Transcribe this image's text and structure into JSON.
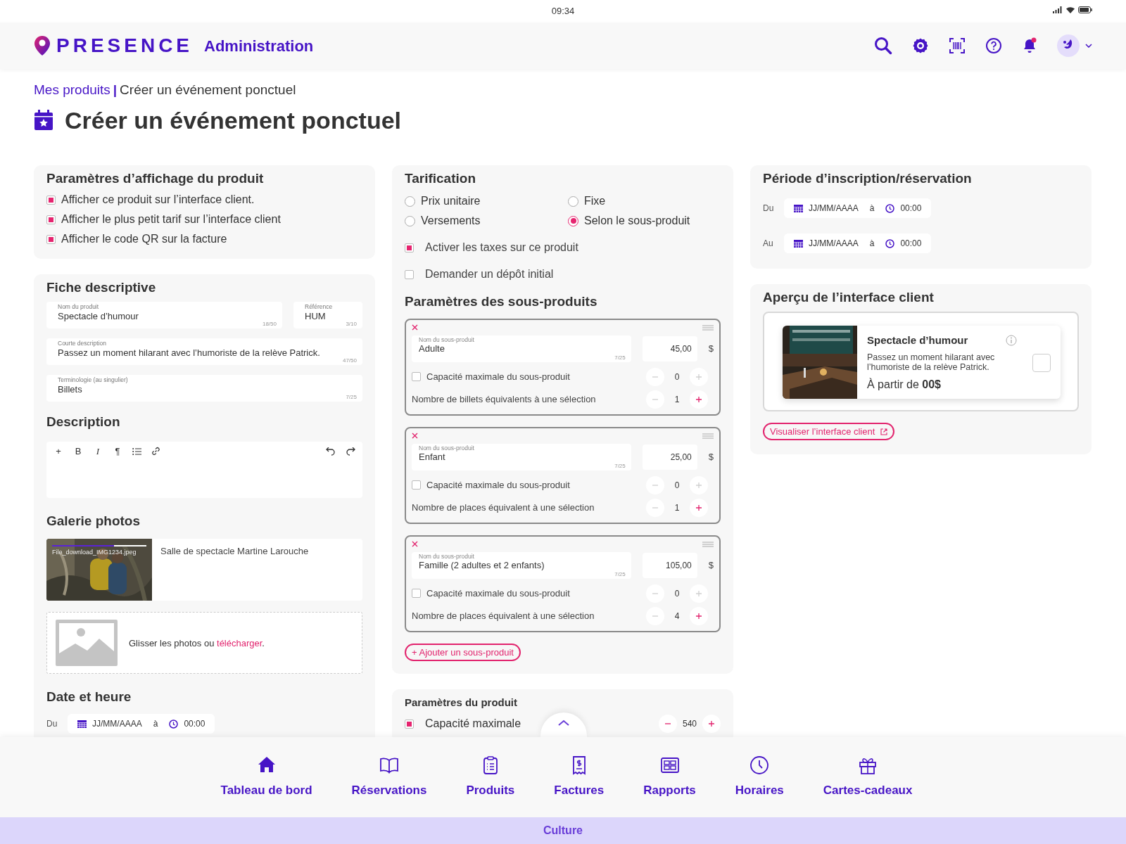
{
  "status_bar": {
    "time": "09:34"
  },
  "header": {
    "brand": "PRESENCE",
    "subtitle": "Administration"
  },
  "breadcrumb": {
    "link": "Mes produits",
    "separator": "|",
    "current": "Créer un événement ponctuel"
  },
  "page_title": "Créer un événement ponctuel",
  "display_settings": {
    "title": "Paramètres d’affichage du produit",
    "options": [
      {
        "label": "Afficher ce produit sur l’interface client.",
        "checked": true
      },
      {
        "label": "Afficher le plus petit tarif sur l’interface client",
        "checked": true
      },
      {
        "label": "Afficher le code QR sur la facture",
        "checked": true
      }
    ]
  },
  "fiche": {
    "title": "Fiche descriptive",
    "fields": [
      {
        "label": "Nom du produit",
        "value": "Spectacle d’humour",
        "counter": "18/50"
      },
      {
        "label": "Référence",
        "value": "HUM",
        "counter": "3/10"
      },
      {
        "label": "Courte description",
        "value": "Passez un moment hilarant avec l’humoriste de la relève Patrick.",
        "counter": "47/50"
      },
      {
        "label": "Terminologie (au singulier)",
        "value": "Billets",
        "counter": "7/25"
      }
    ]
  },
  "description": {
    "title": "Description",
    "toolbar": [
      {
        "kind": "glyph",
        "text": "+"
      },
      {
        "kind": "glyph",
        "text": "B"
      },
      {
        "kind": "italic",
        "text": "I"
      },
      {
        "kind": "glyph",
        "text": "¶"
      },
      {
        "kind": "list"
      },
      {
        "kind": "link"
      }
    ],
    "history": [
      {
        "kind": "undo"
      },
      {
        "kind": "redo"
      }
    ]
  },
  "gallery": {
    "title": "Galerie photos",
    "photos": [
      {
        "filename": "File_download_IMG1234.jpeg",
        "level": 0.66,
        "caption": "Salle de spectacle Martine Larouche"
      }
    ],
    "upload": {
      "text": "Glisser les photos ou",
      "link": "télécharger",
      "after": "."
    }
  },
  "date_time": {
    "title": "Date et heure",
    "rows": [
      {
        "label": "Du",
        "date": "JJ/MM/AAAA",
        "at": "à",
        "time": "00:00"
      }
    ]
  },
  "pricing": {
    "title": "Tarification",
    "modes": [
      {
        "label": "Prix unitaire",
        "selected": false
      },
      {
        "label": "Fixe",
        "selected": false
      },
      {
        "label": "Versements",
        "selected": false
      },
      {
        "label": "Selon le sous-produit",
        "selected": true
      }
    ],
    "options": [
      {
        "label": "Activer les taxes sur ce produit",
        "checked": true
      },
      {
        "label": "Demander un dépôt initial",
        "checked": false
      }
    ]
  },
  "subproducts": {
    "title": "Paramètres des sous-produits",
    "items": [
      {
        "name_label": "Nom du sous-produit",
        "name": "Adulte",
        "counter": "7/25",
        "price": "45,00",
        "currency": "$",
        "capacity": {
          "label": "Capacité maximale du sous-produit",
          "checked": false,
          "value": "0"
        },
        "equivalent": {
          "label": "Nombre de billets équivalents à une sélection",
          "value": "1",
          "minus_disabled": true
        }
      },
      {
        "name_label": "Nom du sous-produit",
        "name": "Enfant",
        "counter": "7/25",
        "price": "25,00",
        "currency": "$",
        "capacity": {
          "label": "Capacité maximale du sous-produit",
          "checked": false,
          "value": "0"
        },
        "equivalent": {
          "label": "Nombre de places équivalent à une sélection",
          "value": "1",
          "minus_disabled": true
        }
      },
      {
        "name_label": "Nom du sous-produit",
        "name": "Famille (2 adultes et 2 enfants)",
        "counter": "7/25",
        "price": "105,00",
        "currency": "$",
        "capacity": {
          "label": "Capacité maximale du sous-produit",
          "checked": false,
          "value": "0"
        },
        "equivalent": {
          "label": "Nombre de places équivalent à une sélection",
          "value": "4",
          "minus_disabled": true
        }
      }
    ],
    "add_button": "+ Ajouter un sous-produit"
  },
  "product_params": {
    "title": "Paramètres du produit",
    "rows": [
      {
        "label": "Capacité maximale",
        "checked": true,
        "value": "540"
      }
    ]
  },
  "period": {
    "title": "Période d’inscription/réservation",
    "rows": [
      {
        "label": "Du",
        "date": "JJ/MM/AAAA",
        "at": "à",
        "time": "00:00"
      },
      {
        "label": "Au",
        "date": "JJ/MM/AAAA",
        "at": "à",
        "time": "00:00"
      }
    ]
  },
  "preview": {
    "title": "Aperçu de l’interface client",
    "card": {
      "name": "Spectacle d’humour",
      "description": "Passez un moment hilarant avec l’humoriste de la relève Patrick.",
      "price": "À partir de **00$**",
      "checked": false
    },
    "link": "Visualiser l’interface client"
  },
  "bottom_nav": {
    "items": [
      {
        "kind": "home",
        "label": "Tableau de bord"
      },
      {
        "kind": "book",
        "label": "Réservations"
      },
      {
        "kind": "clipboard",
        "label": "Produits"
      },
      {
        "kind": "invoice",
        "label": "Factures"
      },
      {
        "kind": "reports",
        "label": "Rapports"
      },
      {
        "kind": "clock",
        "label": "Horaires"
      },
      {
        "kind": "gift",
        "label": "Cartes-cadeaux"
      }
    ]
  },
  "footer": {
    "label": "Culture"
  }
}
